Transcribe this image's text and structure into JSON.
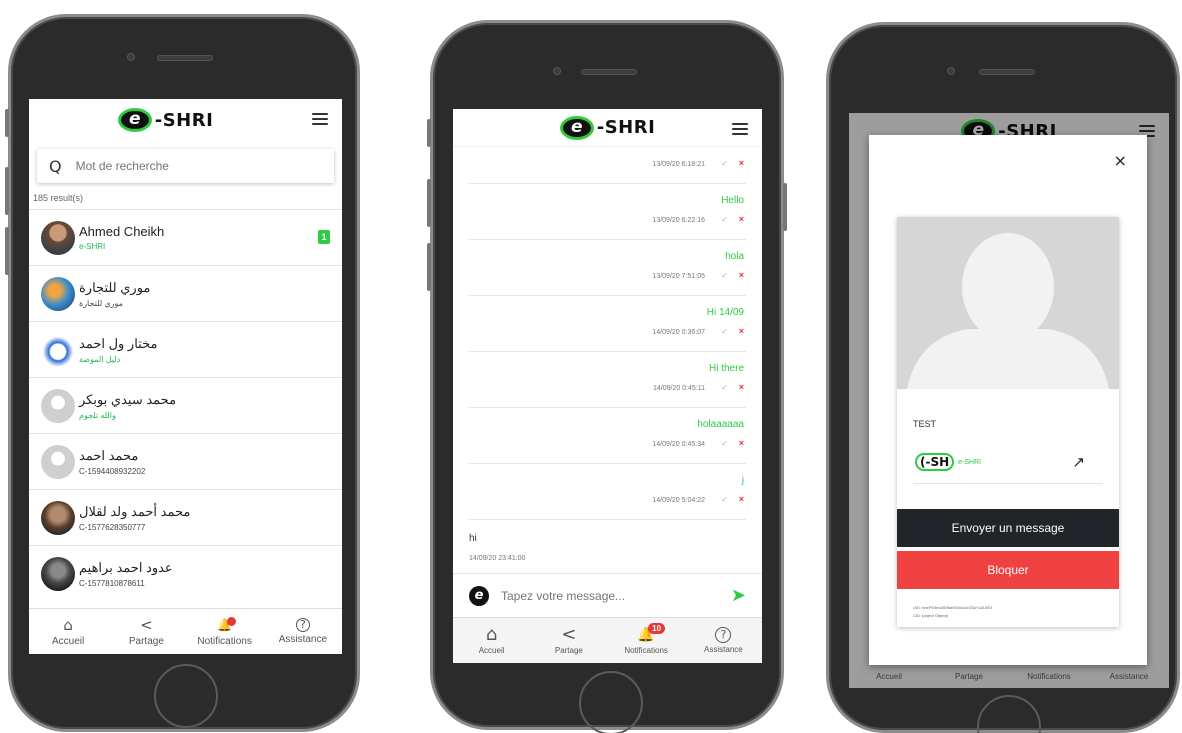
{
  "app": {
    "logo_letter": "e",
    "logo_text": "-SHRI"
  },
  "nav": [
    {
      "label": "Accueil",
      "icon": "home-icon",
      "glyph": "⌂"
    },
    {
      "label": "Partage",
      "icon": "share-icon",
      "glyph": "<"
    },
    {
      "label": "Notifications",
      "icon": "bell-icon",
      "glyph": "🔔"
    },
    {
      "label": "Assistance",
      "icon": "help-icon",
      "glyph": "?"
    }
  ],
  "screen1": {
    "search": {
      "placeholder": "Mot de recherche",
      "icon_glyph": "Q"
    },
    "result_count": "185 result(s)",
    "notification_badge": "",
    "contacts": [
      {
        "name": "Ahmed Cheikh",
        "sub": "e-SHRI",
        "sub_green": true,
        "badge": "1",
        "avatar_color": "#6b4a3a"
      },
      {
        "name": "موري للتجارة",
        "sub": "موري للتجارة",
        "sub_green": false,
        "badge": "",
        "avatar_color": "#3a8ccf"
      },
      {
        "name": "مختار ول احمد",
        "sub": "دليل الموضة",
        "sub_green": true,
        "badge": "",
        "avatar_color": "#2f6fd6"
      },
      {
        "name": "محمد سيدي بوبكر",
        "sub": "والله تلجوم",
        "sub_green": true,
        "badge": "",
        "avatar_color": "#cfcfcf"
      },
      {
        "name": "محمد احمد",
        "sub": "C-1594408932202",
        "sub_green": false,
        "badge": "",
        "avatar_color": "#cfcfcf"
      },
      {
        "name": "محمد أحمد ولد لقلال",
        "sub": "C-1577628350777",
        "sub_green": false,
        "badge": "",
        "avatar_color": "#5a3f2e"
      },
      {
        "name": "عدود احمد براهيم",
        "sub": "C-1577810878611",
        "sub_green": false,
        "badge": "",
        "avatar_color": "#4a4a4a"
      }
    ]
  },
  "screen2": {
    "notification_badge": "10",
    "messages": [
      {
        "text": "",
        "time": "13/09/20 6:18:21"
      },
      {
        "text": "Hello",
        "time": "13/09/20 6:22:16"
      },
      {
        "text": "hola",
        "time": "13/09/20 7:51:05"
      },
      {
        "text": "Hi 14/09",
        "time": "14/09/20 0:36:07"
      },
      {
        "text": "Hi there",
        "time": "14/09/20 0:45:11"
      },
      {
        "text": "holaaaaaa",
        "time": "14/09/20 0:45:34"
      },
      {
        "text": "j",
        "time": "14/09/20 5:04:22"
      }
    ],
    "incoming": {
      "text": "hi",
      "time": "14/09/20 23:41:00"
    },
    "compose": {
      "placeholder": "Tapez votre message...",
      "logo_letter": "e"
    },
    "check_glyph": "✓",
    "x_glyph": "×"
  },
  "screen3": {
    "close_glyph": "×",
    "profile_name": "TEST",
    "brand_pill": "(-SH",
    "brand_label": "e-SHRI",
    "external_link_glyph": "↗",
    "send_button": "Envoyer un message",
    "block_button": "Bloquer",
    "meta_line1": "UID: hnePE9eu459Ba9Gb4uUrl23uYu2L8E3",
    "meta_line2": "CID: [object Object]"
  },
  "colors": {
    "brand_green": "#2ecc40",
    "danger_red": "#f04141",
    "dark_button": "#212529",
    "badge_red": "#e53935"
  }
}
